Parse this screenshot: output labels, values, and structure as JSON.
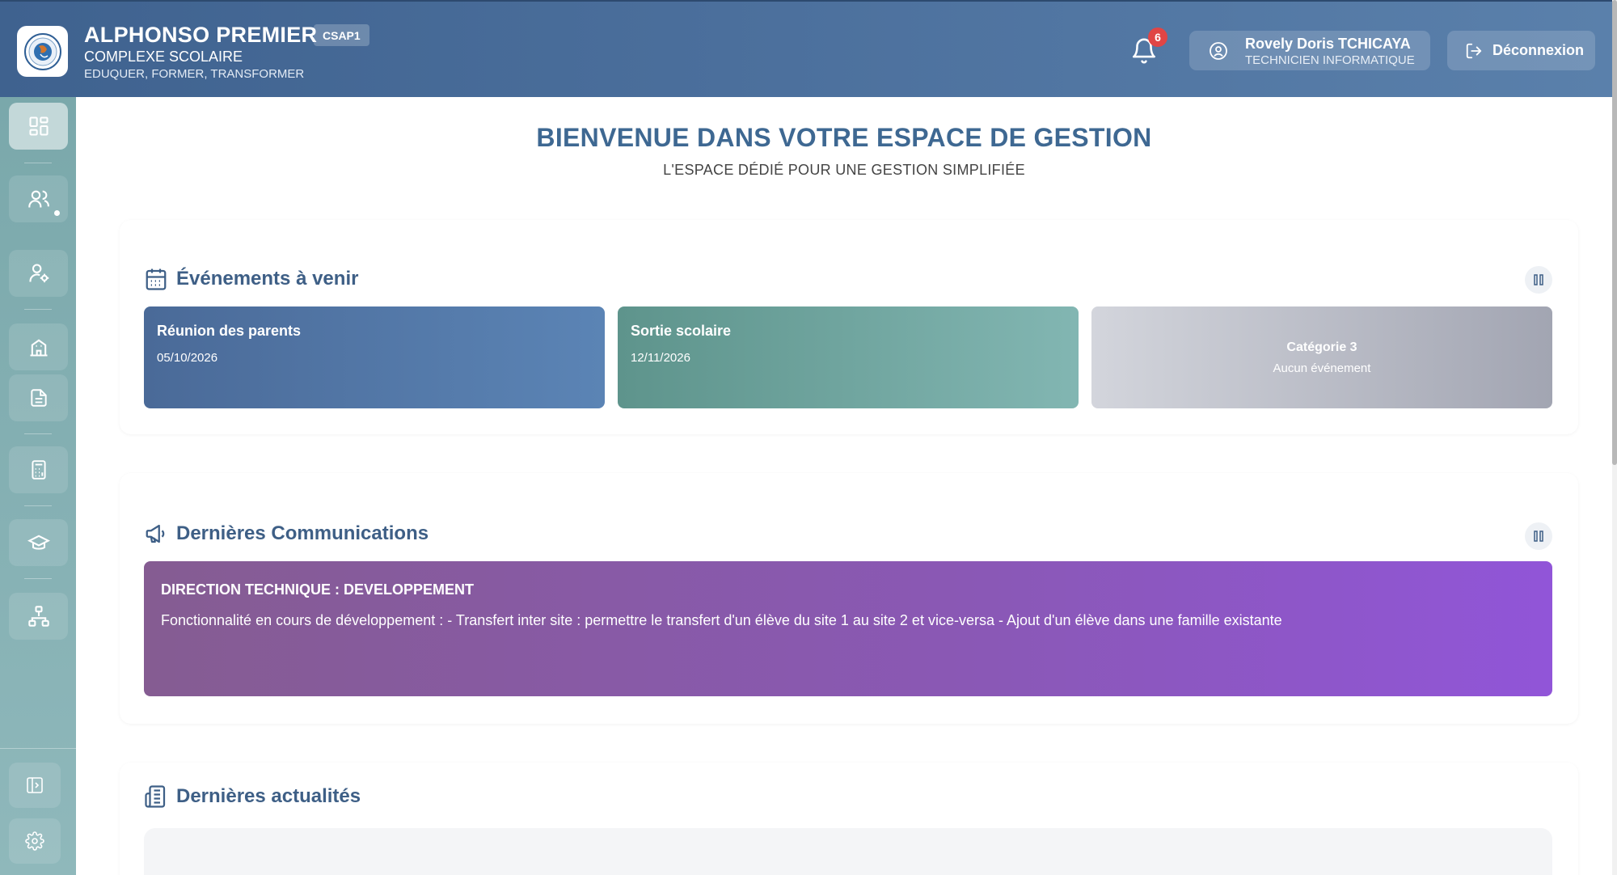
{
  "header": {
    "brand_title": "ALPHONSO PREMIER",
    "brand_subtitle": "COMPLEXE SCOLAIRE",
    "brand_motto": "EDUQUER, FORMER, TRANSFORMER",
    "site_badge": "CSAP1",
    "notification_count": "6",
    "user_name": "Rovely Doris TCHICAYA",
    "user_role": "TECHNICIEN INFORMATIQUE",
    "logout_label": "Déconnexion"
  },
  "sidebar": {
    "items": [
      {
        "icon": "dashboard-icon",
        "active": true
      },
      {
        "icon": "users-icon",
        "active": false
      },
      {
        "icon": "user-settings-icon",
        "active": false
      },
      {
        "icon": "school-building-icon",
        "active": false
      },
      {
        "icon": "document-icon",
        "active": false
      },
      {
        "icon": "calculator-icon",
        "active": false
      },
      {
        "icon": "graduation-cap-icon",
        "active": false
      },
      {
        "icon": "organization-icon",
        "active": false
      }
    ],
    "bottom": [
      {
        "icon": "collapse-panel-icon"
      },
      {
        "icon": "gear-icon"
      }
    ]
  },
  "main": {
    "title": "BIENVENUE DANS VOTRE ESPACE DE GESTION",
    "subtitle": "L'ESPACE DÉDIÉ POUR UNE GESTION SIMPLIFIÉE"
  },
  "events": {
    "title": "Événements à venir",
    "items": [
      {
        "title": "Réunion des parents",
        "date": "05/10/2026"
      },
      {
        "title": "Sortie scolaire",
        "date": "12/11/2026"
      }
    ],
    "empty": {
      "title": "Catégorie 3",
      "text": "Aucun événement"
    }
  },
  "communications": {
    "title": "Dernières Communications",
    "item": {
      "title": "DIRECTION TECHNIQUE : DEVELOPPEMENT",
      "text": "Fonctionnalité en cours de développement : - Transfert inter site : permettre le transfert d'un élève du site 1 au site 2 et vice-versa - Ajout d'un élève dans une famille existante"
    }
  },
  "news": {
    "title": "Dernières actualités"
  },
  "colors": {
    "header": "#4b6f9c",
    "sidebar": "#7aa8ab",
    "title": "#3e6892",
    "notification": "#e04545"
  }
}
